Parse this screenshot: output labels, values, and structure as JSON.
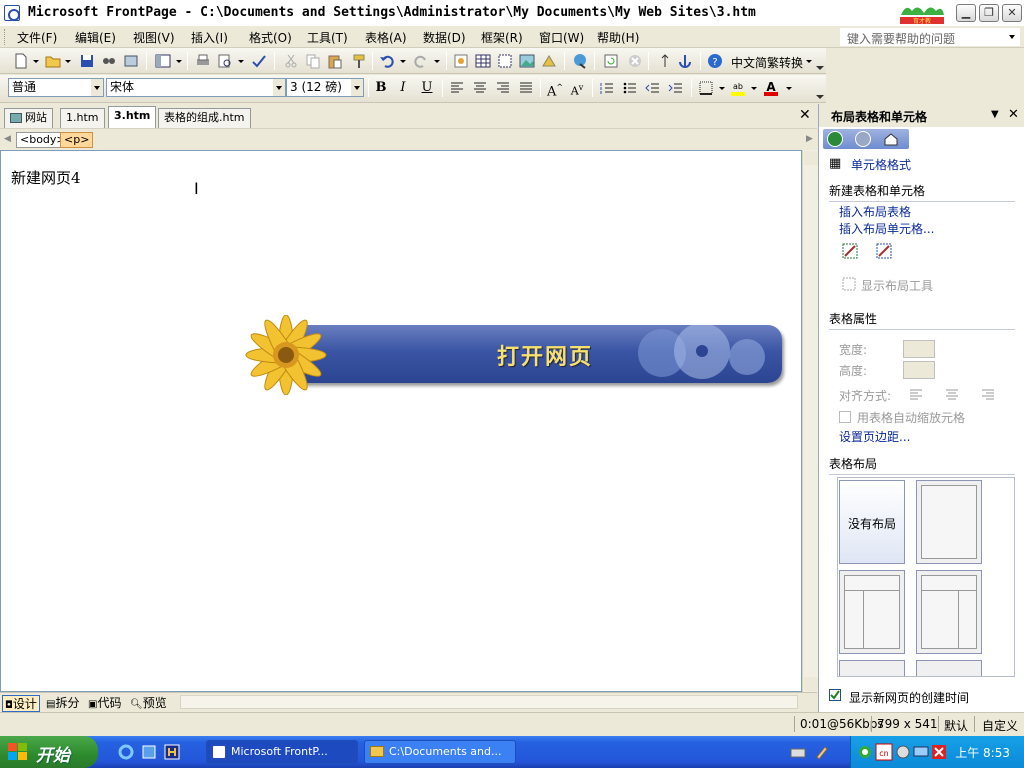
{
  "window": {
    "title": "Microsoft FrontPage - C:\\Documents and Settings\\Administrator\\My Documents\\My Web Sites\\3.htm",
    "controls": [
      "minimize",
      "restore",
      "close"
    ]
  },
  "menubar": {
    "items": [
      "文件(F)",
      "编辑(E)",
      "视图(V)",
      "插入(I)",
      "格式(O)",
      "工具(T)",
      "表格(A)",
      "数据(D)",
      "框架(R)",
      "窗口(W)",
      "帮助(H)"
    ],
    "help_placeholder": "键入需要帮助的问题"
  },
  "toolbar": {
    "convert_label": "中文简繁转换"
  },
  "format_toolbar": {
    "style_value": "普通",
    "font_value": "宋体",
    "size_value": "3 (12 磅)",
    "bold": "B",
    "italic": "I",
    "underline": "U"
  },
  "tabs": {
    "items": [
      "网站",
      "1.htm",
      "3.htm",
      "表格的组成.htm"
    ],
    "active": "3.htm"
  },
  "tagbar": {
    "tags": [
      "<body>",
      "<p>"
    ]
  },
  "editor": {
    "text": "新建网页4",
    "banner_text": "打开网页"
  },
  "viewbar": {
    "items": [
      "设计",
      "拆分",
      "代码",
      "预览"
    ],
    "active": "设计"
  },
  "taskpane": {
    "title": "布局表格和单元格",
    "cell_format_link": "单元格格式",
    "section_new": "新建表格和单元格",
    "insert_table_link": "插入布局表格",
    "insert_cell_link": "插入布局单元格...",
    "show_tools": "显示布局工具",
    "section_props": "表格属性",
    "width_label": "宽度:",
    "height_label": "高度:",
    "align_label": "对齐方式:",
    "autoscale_label": "用表格自动缩放元格",
    "margins_link": "设置页边距...",
    "section_layout": "表格布局",
    "no_layout": "没有布局",
    "show_created": "显示新网页的创建时间"
  },
  "statusbar": {
    "speed": "0:01@56Kbps",
    "size": "799 x 541",
    "default": "默认",
    "custom": "自定义"
  },
  "taskbar": {
    "start": "开始",
    "tasks": [
      "Microsoft FrontP...",
      "C:\\Documents and..."
    ],
    "clock": "上午 8:53"
  },
  "colors": {
    "taskbar_blue": "#2456da",
    "start_green": "#2d8a2d",
    "link_blue": "#0a2a9a",
    "banner_blue": "#3a55a4",
    "banner_text": "#f5e070"
  }
}
